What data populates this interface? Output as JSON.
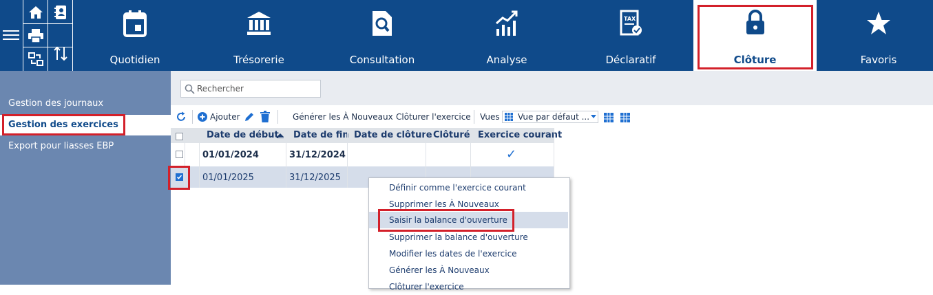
{
  "topbar": {
    "tabs": [
      {
        "label": "Quotidien",
        "icon": "calendar-icon"
      },
      {
        "label": "Trésorerie",
        "icon": "bank-icon"
      },
      {
        "label": "Consultation",
        "icon": "document-search-icon"
      },
      {
        "label": "Analyse",
        "icon": "chart-icon"
      },
      {
        "label": "Déclaratif",
        "icon": "tax-icon"
      },
      {
        "label": "Clôture",
        "icon": "lock-icon"
      },
      {
        "label": "Favoris",
        "icon": "star-icon"
      }
    ],
    "active_tab": "Clôture",
    "colors": {
      "brand": "#0f4a8a",
      "highlight": "#d3202a"
    }
  },
  "sidebar": {
    "items": [
      {
        "label": "Gestion des journaux"
      },
      {
        "label": "Gestion des exercices"
      },
      {
        "label": "Export pour liasses EBP"
      }
    ]
  },
  "search": {
    "placeholder": "Rechercher"
  },
  "toolbar": {
    "add_label": "Ajouter",
    "generate_label": "Générer les À Nouveaux",
    "close_label": "Clôturer l'exercice",
    "views_label": "Vues",
    "view_selected": "Vue par défaut ..."
  },
  "grid": {
    "columns": [
      "Date de début",
      "Date de fin",
      "Date de clôture",
      "Clôturé",
      "Exercice courant"
    ],
    "rows": [
      {
        "start": "01/01/2024",
        "end": "31/12/2024",
        "closing": "",
        "closed": "",
        "current": "✓",
        "checked": false
      },
      {
        "start": "01/01/2025",
        "end": "31/12/2025",
        "closing": "",
        "closed": "",
        "current": "",
        "checked": true
      }
    ]
  },
  "context_menu": {
    "items": [
      "Définir comme l'exercice courant",
      "Supprimer les À Nouveaux",
      "Saisir la balance d'ouverture",
      "Supprimer la balance d'ouverture",
      "Modifier les dates de l'exercice",
      "Générer les À Nouveaux",
      "Clôturer l'exercice"
    ]
  }
}
